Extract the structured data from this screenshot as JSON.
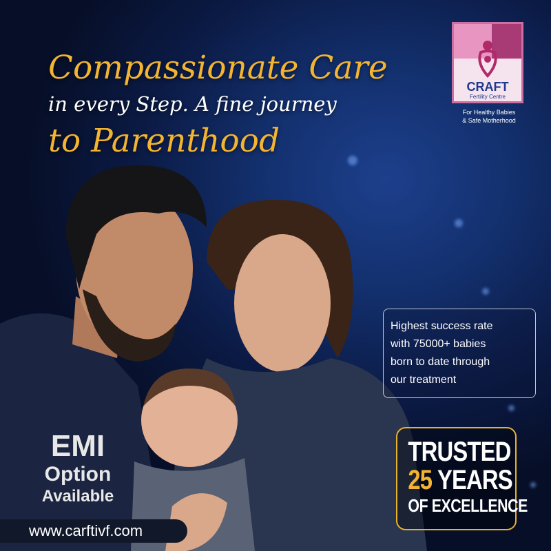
{
  "headline": {
    "line1": "Compassionate Care",
    "line2": "in every Step. A fine journey",
    "line3": "to Parenthood"
  },
  "logo": {
    "name": "CRAFT",
    "subtitle": "Fertility Centre",
    "tagline_1": "For Healthy Babies",
    "tagline_2": "& Safe Motherhood"
  },
  "success_card": {
    "lines": [
      "Highest success rate",
      "with 75000+ babies",
      "born to date through",
      "our treatment"
    ]
  },
  "trusted_badge": {
    "line1": "TRUSTED",
    "years_number": "25",
    "years_word": "YEARS",
    "line3": "OF EXCELLENCE"
  },
  "emi": {
    "line1": "EMI",
    "line2": "Option",
    "line3": "Available"
  },
  "website": "www.carftivf.com",
  "colors": {
    "gold": "#f2b431",
    "background": "#0b1a44",
    "logo_pink": "#e896c1",
    "logo_magenta": "#a83a76",
    "logo_blue": "#203a8a"
  }
}
